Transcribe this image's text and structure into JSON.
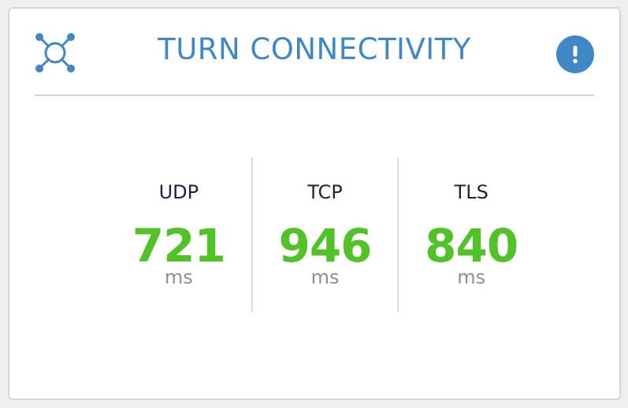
{
  "card": {
    "title": "TURN CONNECTIVITY",
    "icon": "network-nodes-icon",
    "alert_icon": "exclamation-icon",
    "colors": {
      "accent": "#3f88c5",
      "value": "#52c229",
      "label": "#1d2340",
      "unit": "#8a8f98"
    }
  },
  "metrics": [
    {
      "protocol": "UDP",
      "value": "721",
      "unit": "ms"
    },
    {
      "protocol": "TCP",
      "value": "946",
      "unit": "ms"
    },
    {
      "protocol": "TLS",
      "value": "840",
      "unit": "ms"
    }
  ]
}
